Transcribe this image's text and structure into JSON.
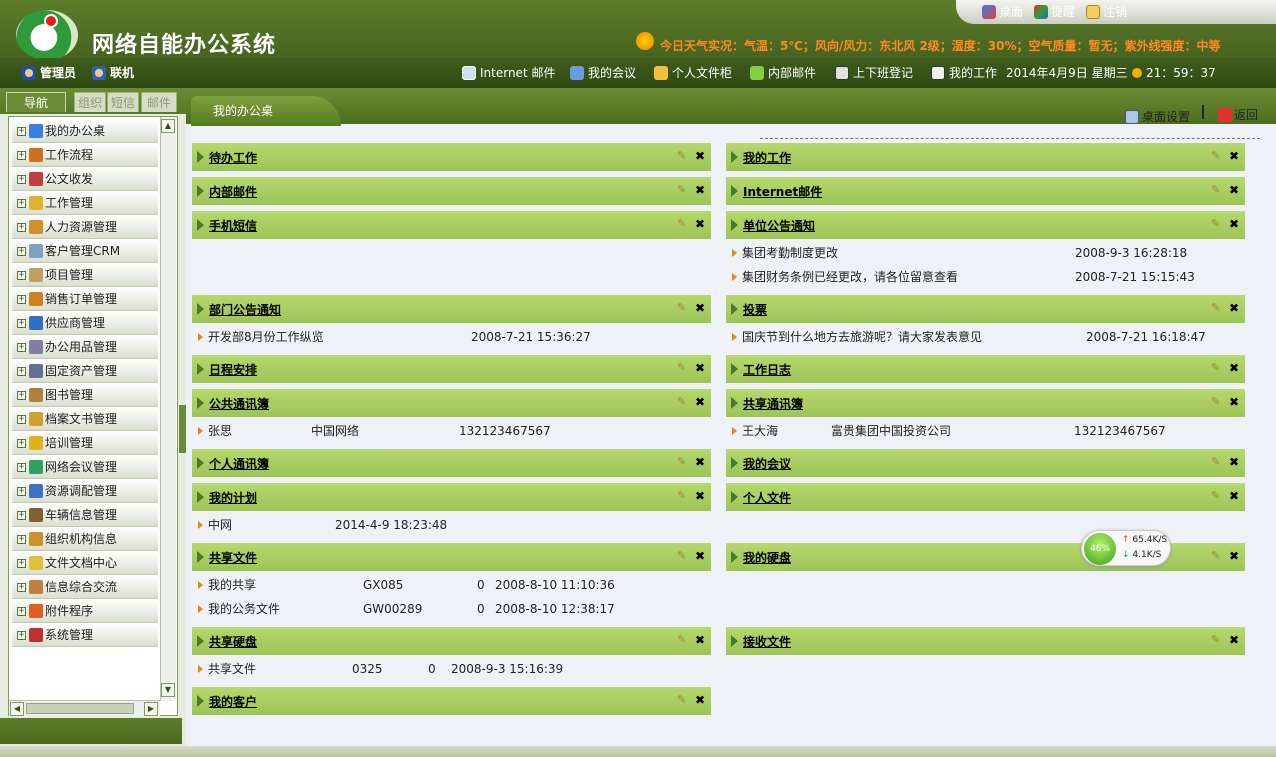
{
  "app": {
    "title": "网络自能办公系统"
  },
  "top_links": [
    {
      "label": "桌面",
      "icon": "desktop-icon"
    },
    {
      "label": "提醒",
      "icon": "reminder-icon"
    },
    {
      "label": "注销",
      "icon": "logout-icon"
    }
  ],
  "weather": "今日天气实况：气温：5℃；风向/风力：东北风 2级；湿度：30%；空气质量：暂无；紫外线强度：中等",
  "user": {
    "role": "管理员",
    "status": "联机"
  },
  "quick_links": [
    "Internet 邮件",
    "我的会议",
    "个人文件柜",
    "内部邮件",
    "上下班登记",
    "我的工作"
  ],
  "datetime": {
    "date": "2014年4月9日 星期三",
    "time": "21：59：37"
  },
  "left_tabs": [
    "导航",
    "组织",
    "短信",
    "邮件"
  ],
  "nav_items": [
    "我的办公桌",
    "工作流程",
    "公文收发",
    "工作管理",
    "人力资源管理",
    "客户管理CRM",
    "项目管理",
    "销售订单管理",
    "供应商管理",
    "办公用品管理",
    "固定资产管理",
    "图书管理",
    "档案文书管理",
    "培训管理",
    "网络会议管理",
    "资源调配管理",
    "车辆信息管理",
    "组织机构信息",
    "文件文档中心",
    "信息综合交流",
    "附件程序",
    "系统管理"
  ],
  "content": {
    "tab": "我的办公桌",
    "desk_settings": "桌面设置",
    "back": "返回",
    "panels": {
      "p0": {
        "title": "待办工作"
      },
      "p1": {
        "title": "我的工作"
      },
      "p2": {
        "title": "内部邮件"
      },
      "p3": {
        "title": "Internet邮件"
      },
      "p4": {
        "title": "手机短信"
      },
      "p5": {
        "title": "单位公告通知",
        "rows": [
          {
            "text": "集团考勤制度更改",
            "time": "2008-9-3 16:28:18"
          },
          {
            "text": "集团财务条例已经更改，请各位留意查看",
            "time": "2008-7-21 15:15:43"
          }
        ]
      },
      "p6": {
        "title": "部门公告通知",
        "rows": [
          {
            "text": "开发部8月份工作纵览",
            "time": "2008-7-21 15:36:27"
          }
        ]
      },
      "p7": {
        "title": "投票",
        "rows": [
          {
            "text": "国庆节到什么地方去旅游呢？请大家发表意见",
            "time": "2008-7-21 16:18:47"
          }
        ]
      },
      "p8": {
        "title": "日程安排"
      },
      "p9": {
        "title": "工作日志"
      },
      "p10": {
        "title": "公共通讯簿",
        "rows": [
          {
            "name": "张思",
            "org": "中国网络",
            "phone": "132123467567"
          }
        ]
      },
      "p11": {
        "title": "共享通讯簿",
        "rows": [
          {
            "name": "王大海",
            "org": "富贵集团中国投资公司",
            "phone": "132123467567"
          }
        ]
      },
      "p12": {
        "title": "个人通讯簿"
      },
      "p13": {
        "title": "我的会议"
      },
      "p14": {
        "title": "我的计划",
        "rows": [
          {
            "text": "中网",
            "time": "2014-4-9 18:23:48"
          }
        ]
      },
      "p15": {
        "title": "个人文件"
      },
      "p16": {
        "title": "共享文件",
        "rows": [
          {
            "name": "我的共享",
            "code": "GX085",
            "count": "0",
            "time": "2008-8-10 11:10:36"
          },
          {
            "name": "我的公务文件",
            "code": "GW00289",
            "count": "0",
            "time": "2008-8-10 12:38:17"
          }
        ]
      },
      "p17": {
        "title": "我的硬盘"
      },
      "p18": {
        "title": "共享硬盘",
        "rows": [
          {
            "name": "共享文件",
            "code": "0325",
            "count": "0",
            "time": "2008-9-3 15:16:39"
          }
        ]
      },
      "p19": {
        "title": "接收文件"
      },
      "p20": {
        "title": "我的客户"
      }
    }
  },
  "speed_widget": {
    "percent": "46%",
    "up": "65.4K/S",
    "down": "4.1K/S"
  },
  "colors": {
    "header_green": "#4e6d1f",
    "panel_green": "#a8cc60",
    "accent_orange": "#ff8a20"
  }
}
